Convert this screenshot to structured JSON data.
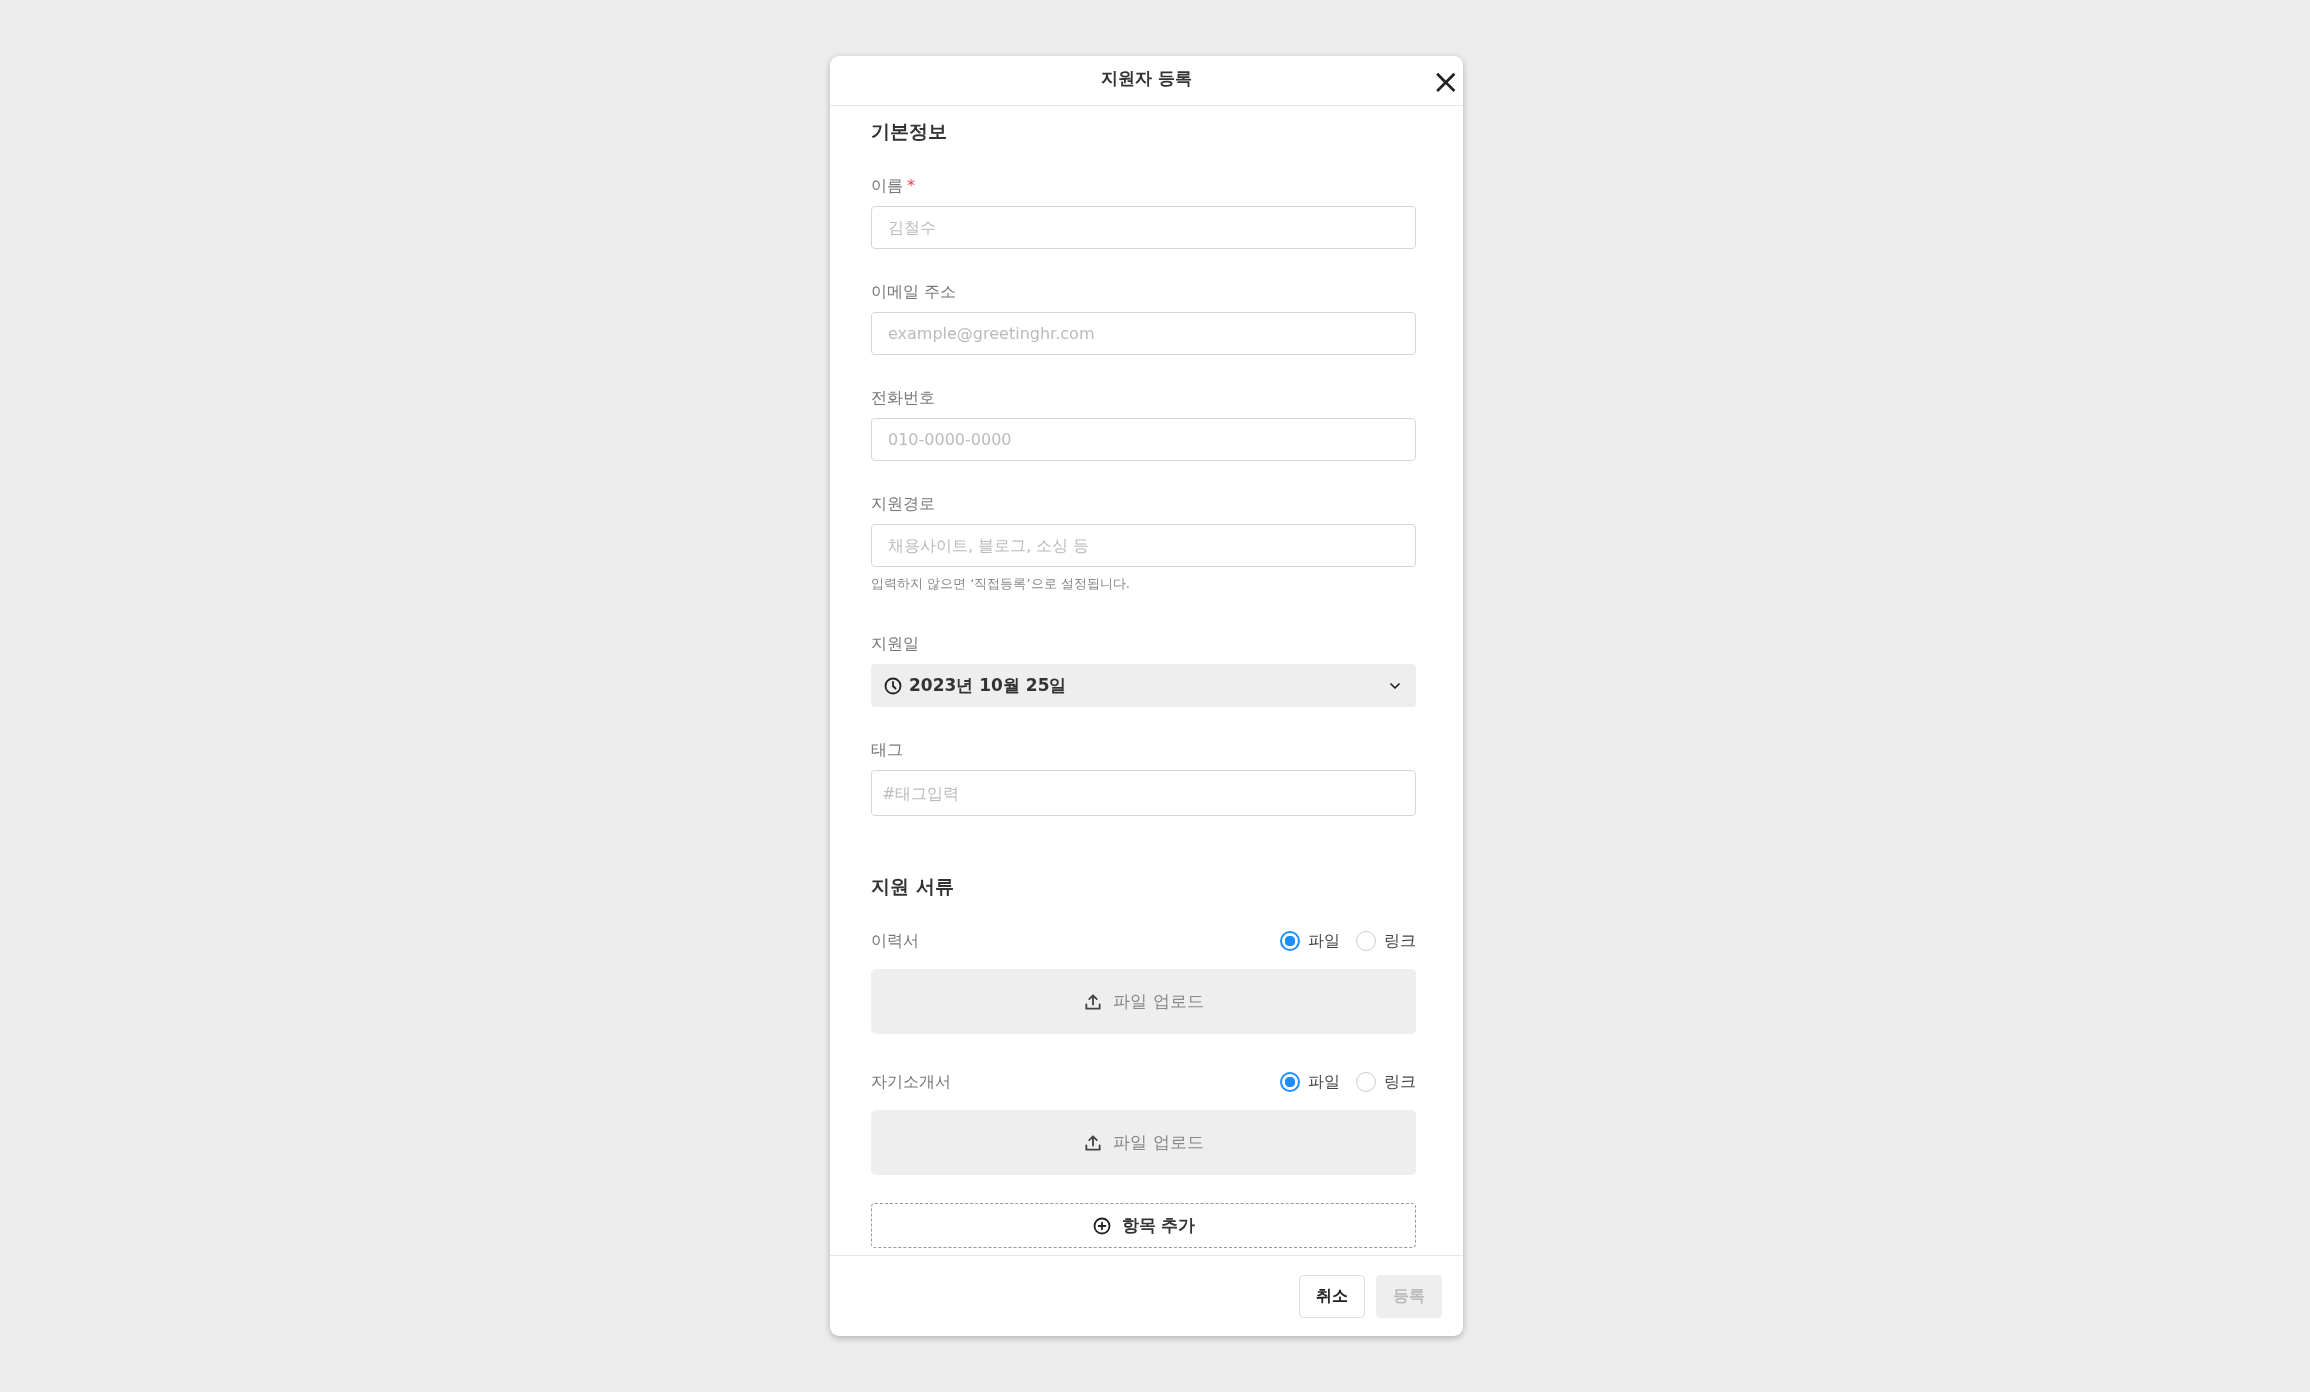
{
  "dialog": {
    "title": "지원자 등록",
    "close": "×"
  },
  "basic": {
    "title": "기본정보",
    "fields": [
      {
        "kind": "text",
        "label": "이름",
        "required_mark": "*",
        "placeholder": "김철수"
      },
      {
        "kind": "text",
        "label": "이메일 주소",
        "placeholder": "example@greetinghr.com"
      },
      {
        "kind": "text",
        "label": "전화번호",
        "placeholder": "010-0000-0000"
      },
      {
        "kind": "text",
        "label": "지원경로",
        "placeholder": "채용사이트, 블로그, 소싱 등",
        "hint": "입력하지 않으면 ‘직접등록’으로 설정됩니다."
      },
      {
        "kind": "date",
        "label": "지원일",
        "value": "2023년 10월 25일"
      },
      {
        "kind": "tag",
        "label": "태그",
        "placeholder": "#태그입력"
      }
    ]
  },
  "documents": {
    "title": "지원 서류",
    "items": [
      {
        "label": "이력서",
        "options": [
          {
            "label": "파일",
            "selected": true
          },
          {
            "label": "링크",
            "selected": false
          }
        ],
        "upload": "파일 업로드"
      },
      {
        "label": "자기소개서",
        "options": [
          {
            "label": "파일",
            "selected": true
          },
          {
            "label": "링크",
            "selected": false
          }
        ],
        "upload": "파일 업로드"
      }
    ],
    "add_button": "항목 추가"
  },
  "footer": {
    "buttons": [
      {
        "label": "취소",
        "disabled": false
      },
      {
        "label": "등록",
        "disabled": true
      }
    ]
  }
}
